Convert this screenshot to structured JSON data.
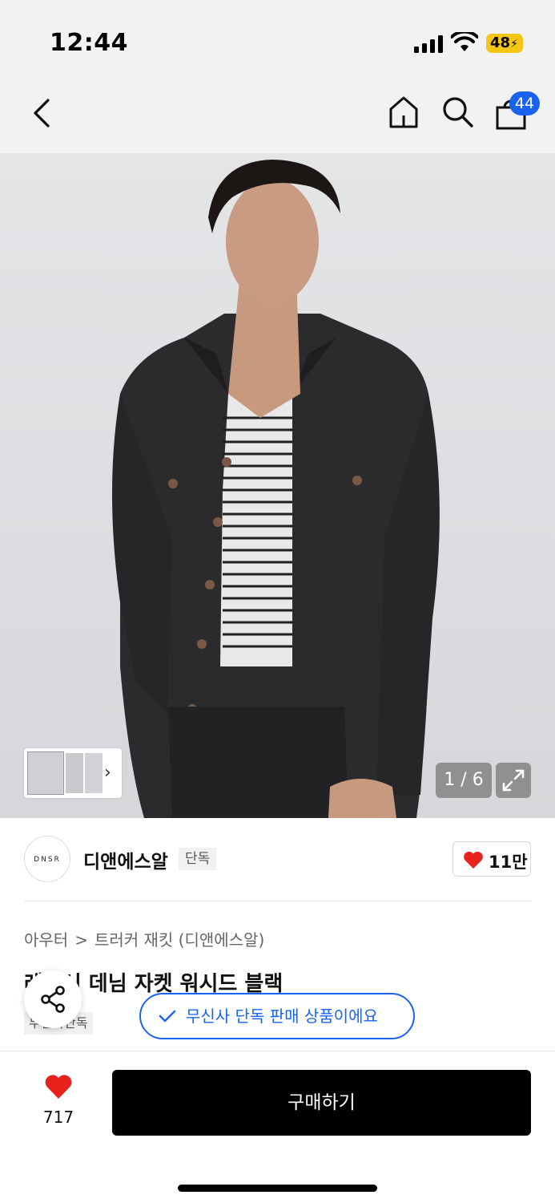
{
  "status_bar": {
    "time": "12:44",
    "battery": "48"
  },
  "nav": {
    "cart_count": "44"
  },
  "gallery": {
    "page_indicator": "1 / 6"
  },
  "brand": {
    "logo_text": "DNSR",
    "name": "디앤에스알",
    "exclusive_tag": "단독",
    "likes": "11만"
  },
  "product": {
    "breadcrumb": [
      "아우터",
      "트러커 재킷 (디앤에스알)"
    ],
    "breadcrumb_separator": ">",
    "title": "레거시 데님 자켓 워시드 블랙",
    "tag": "무신사단독"
  },
  "toast": {
    "message": "무신사 단독 판매 상품이에요"
  },
  "bottom_bar": {
    "like_count": "717",
    "buy_label": "구매하기"
  },
  "colors": {
    "accent_blue": "#1a63f0",
    "heart_red": "#e8231e",
    "battery_yellow": "#f5c518",
    "buy_button": "#000000"
  }
}
